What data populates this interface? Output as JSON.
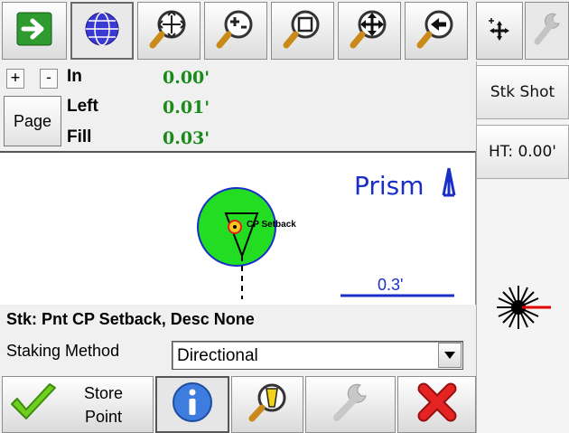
{
  "toolbar": {
    "icons": [
      "arrow-right-icon",
      "globe-icon",
      "zoom-extents-icon",
      "zoom-in-out-icon",
      "zoom-window-icon",
      "pan-icon",
      "zoom-previous-icon",
      "add-point-icon",
      "settings-wrench-icon"
    ]
  },
  "zoom_controls": {
    "plus": "+",
    "minus": "-"
  },
  "page_button": "Page",
  "readouts": [
    {
      "label": "In",
      "value": "0.00'"
    },
    {
      "label": "Left",
      "value": "0.01'"
    },
    {
      "label": "Fill",
      "value": "0.03'"
    }
  ],
  "side": {
    "stake_shot": "Stk Shot",
    "height": "HT: 0.00'"
  },
  "map": {
    "target_label": "Prism",
    "point_label": "CP Setback",
    "scale_label": "0.3'",
    "colors": {
      "target": "#1a2fc8",
      "circle": "#22dd22",
      "circle_border": "#1a2fc8"
    }
  },
  "status_line": "Stk: Pnt CP Setback, Desc None",
  "staking_method": {
    "label": "Staking Method",
    "selected": "Directional"
  },
  "bottom": {
    "store_point_line1": "Store",
    "store_point_line2": "Point"
  }
}
